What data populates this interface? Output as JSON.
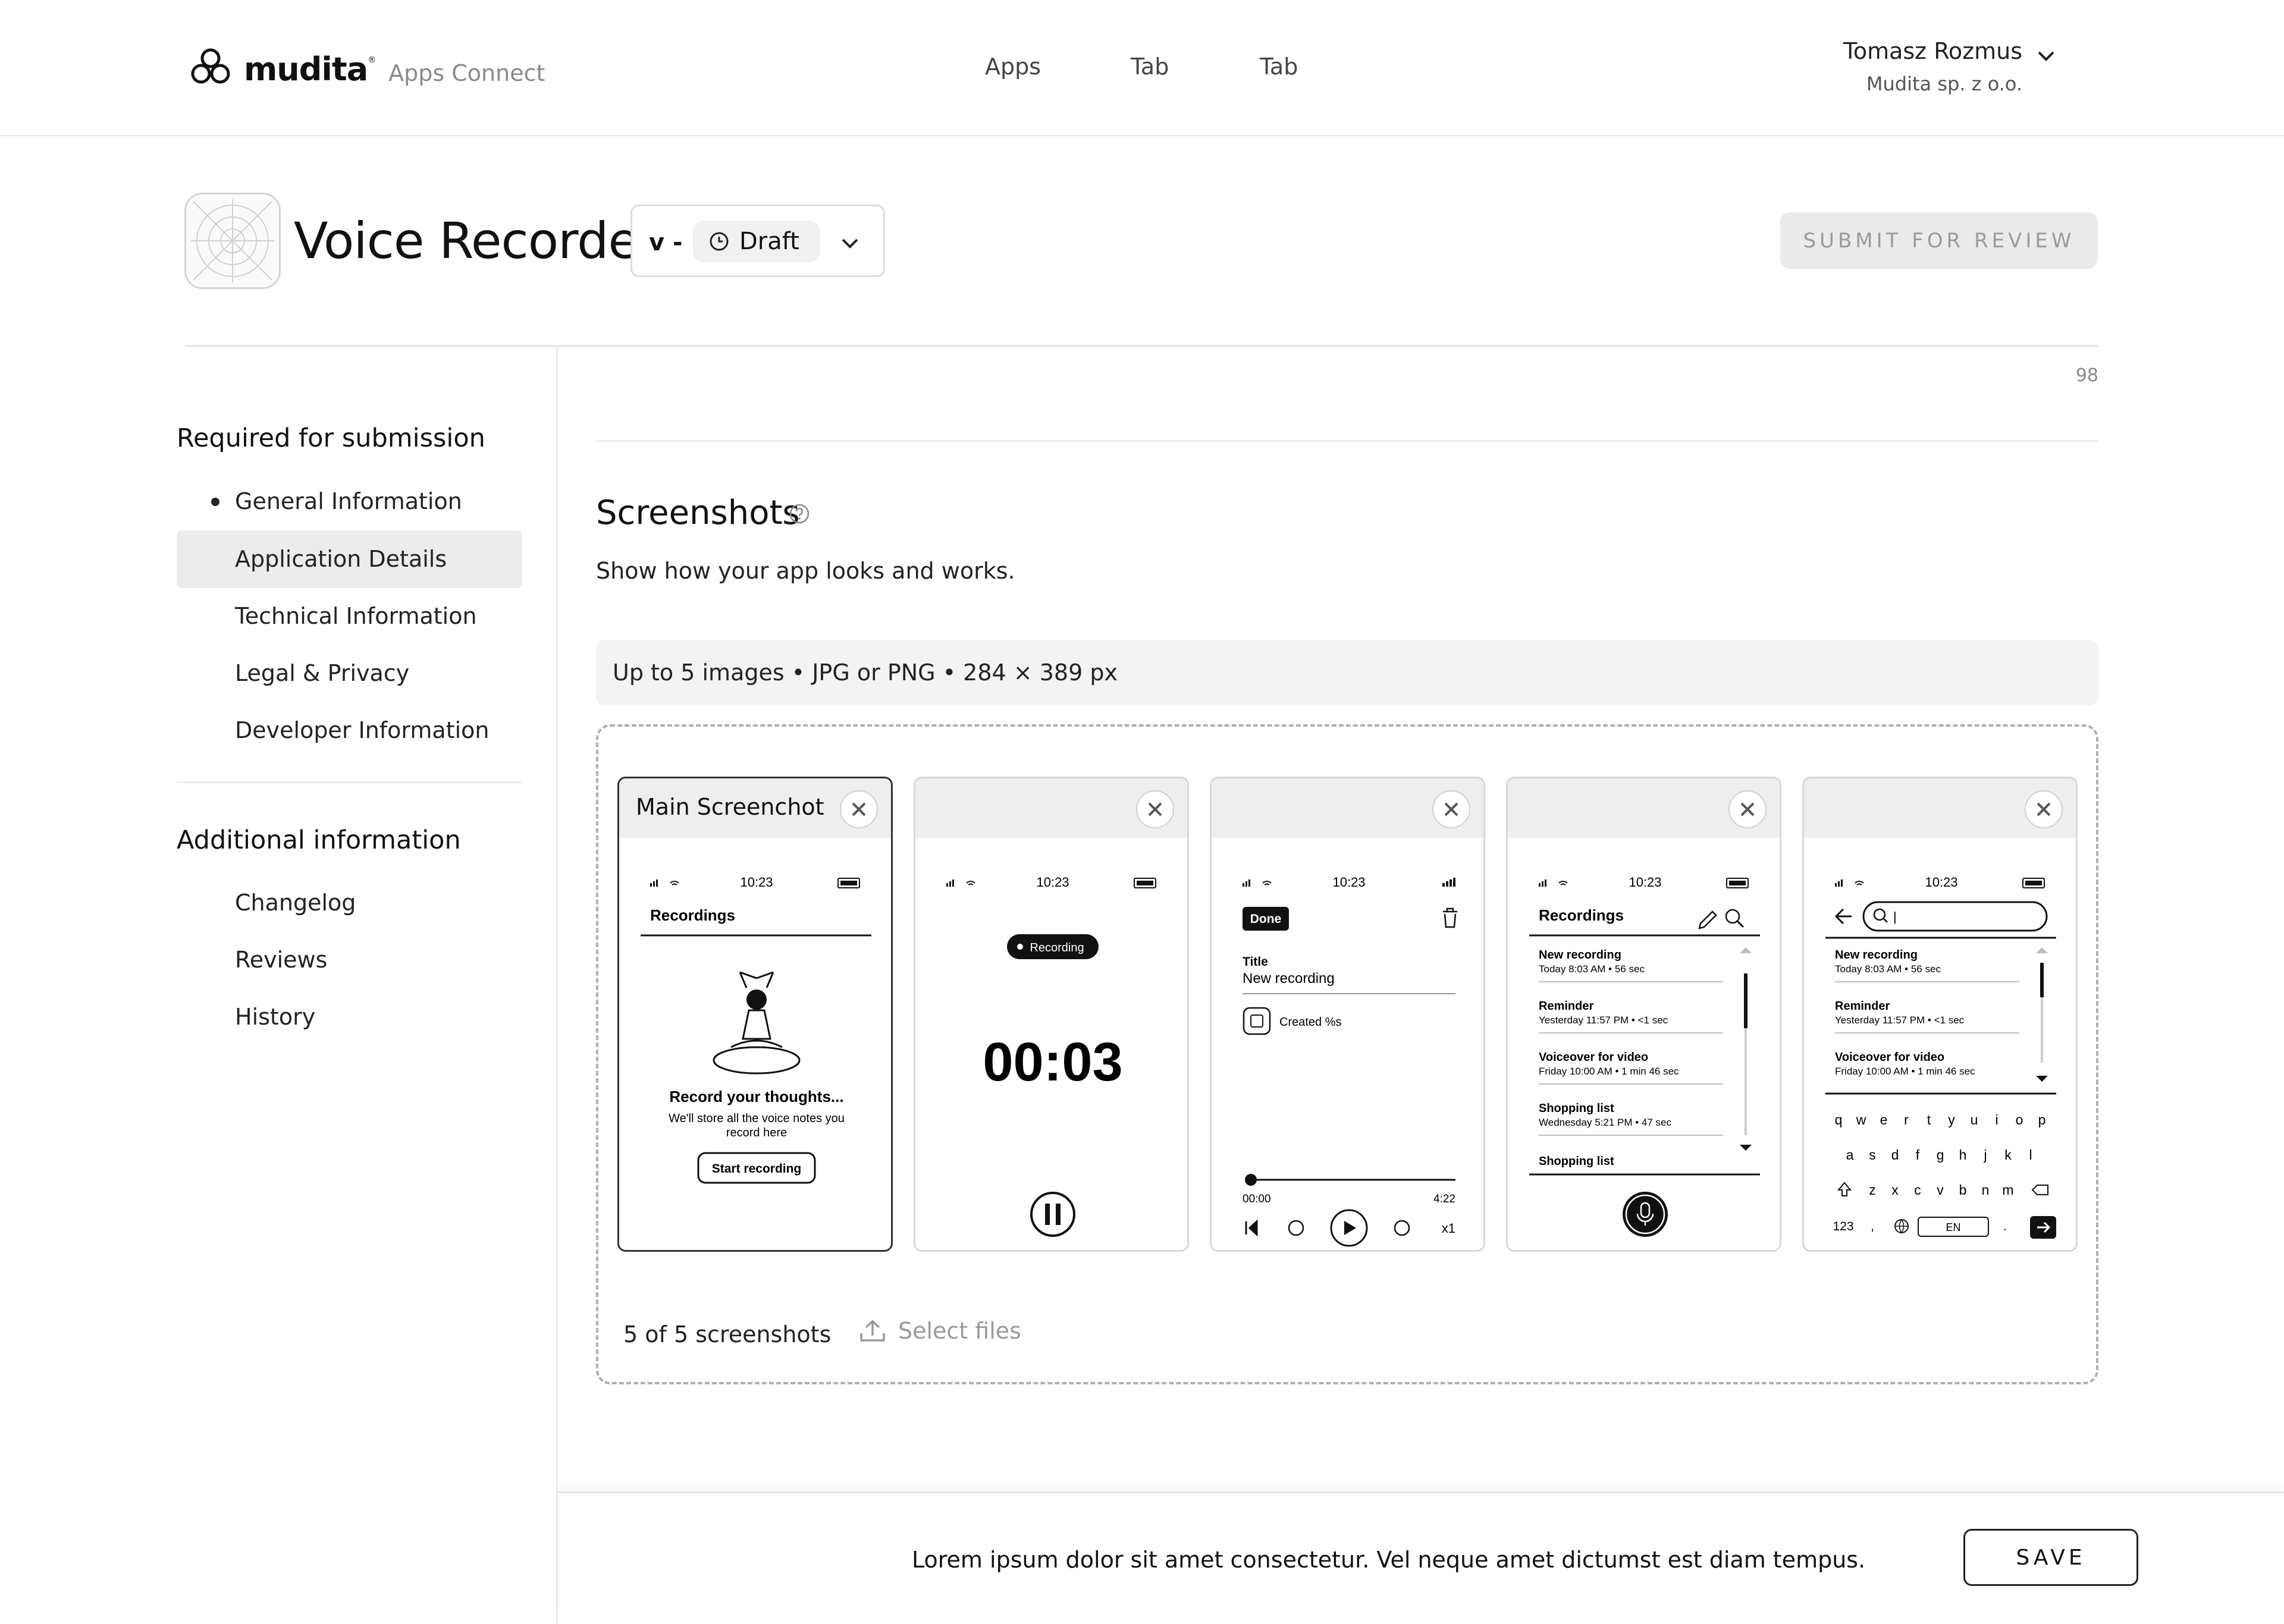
{
  "header": {
    "brand": "mudita",
    "sub_brand": "Apps Connect",
    "nav": [
      "Apps",
      "Tab",
      "Tab"
    ],
    "user_name": "Tomasz Rozmus",
    "user_org": "Mudita sp. z o.o."
  },
  "app": {
    "title": "Voice Recorder",
    "version_prefix": "v -",
    "status": "Draft",
    "submit_label": "SUBMIT FOR REVIEW"
  },
  "sidebar": {
    "required_heading": "Required for submission",
    "required_items": [
      {
        "label": "General Information"
      },
      {
        "label": "Application Details"
      },
      {
        "label": "Technical Information"
      },
      {
        "label": "Legal & Privacy"
      },
      {
        "label": "Developer Information"
      }
    ],
    "additional_heading": "Additional information",
    "additional_items": [
      {
        "label": "Changelog"
      },
      {
        "label": "Reviews"
      },
      {
        "label": "History"
      }
    ]
  },
  "content": {
    "char_count": "98",
    "section_title": "Screenshots",
    "section_desc": "Show how your app looks and works.",
    "requirements": "Up to 5 images • JPG or PNG • 284 × 389 px",
    "screenshot_count": "5 of 5 screenshots",
    "select_files": "Select files"
  },
  "screenshots": [
    {
      "title": "Main Screenchot",
      "time": "10:23",
      "header": "Recordings",
      "empty_title": "Record your thoughts...",
      "empty_line1": "We'll store all the voice notes you",
      "empty_line2": "record here",
      "button": "Start recording"
    },
    {
      "title": "",
      "time": "10:23",
      "badge": "Recording",
      "timer": "00:03"
    },
    {
      "title": "",
      "time": "10:23",
      "done": "Done",
      "field_label": "Title",
      "field_value": "New recording",
      "created": "Created %s",
      "start": "00:00",
      "end": "4:22",
      "speed": "x1"
    },
    {
      "title": "",
      "time": "10:23",
      "header": "Recordings",
      "items": [
        {
          "name": "New recording",
          "meta": "Today 8:03 AM • 56 sec"
        },
        {
          "name": "Reminder",
          "meta": "Yesterday 11:57 PM • <1 sec"
        },
        {
          "name": "Voiceover for video",
          "meta": "Friday 10:00 AM • 1 min 46 sec"
        },
        {
          "name": "Shopping list",
          "meta": "Wednesday 5:21 PM • 47 sec"
        }
      ],
      "now_playing": "Shopping list"
    },
    {
      "title": "",
      "time": "10:23",
      "search": "|",
      "items": [
        {
          "name": "New recording",
          "meta": "Today 8:03 AM • 56 sec"
        },
        {
          "name": "Reminder",
          "meta": "Yesterday 11:57 PM • <1 sec"
        },
        {
          "name": "Voiceover for video",
          "meta": "Friday 10:00 AM • 1 min 46 sec"
        }
      ],
      "row1": [
        "q",
        "w",
        "e",
        "r",
        "t",
        "y",
        "u",
        "i",
        "o",
        "p"
      ],
      "row2": [
        "a",
        "s",
        "d",
        "f",
        "g",
        "h",
        "j",
        "k",
        "l"
      ],
      "row3": [
        "z",
        "x",
        "c",
        "v",
        "b",
        "n",
        "m"
      ],
      "num_key": "123",
      "comma": ",",
      "lang": "EN",
      "period": "."
    }
  ],
  "footer": {
    "message": "Lorem ipsum dolor sit amet consectetur. Vel neque amet dictumst est diam tempus.",
    "save_label": "SAVE"
  }
}
